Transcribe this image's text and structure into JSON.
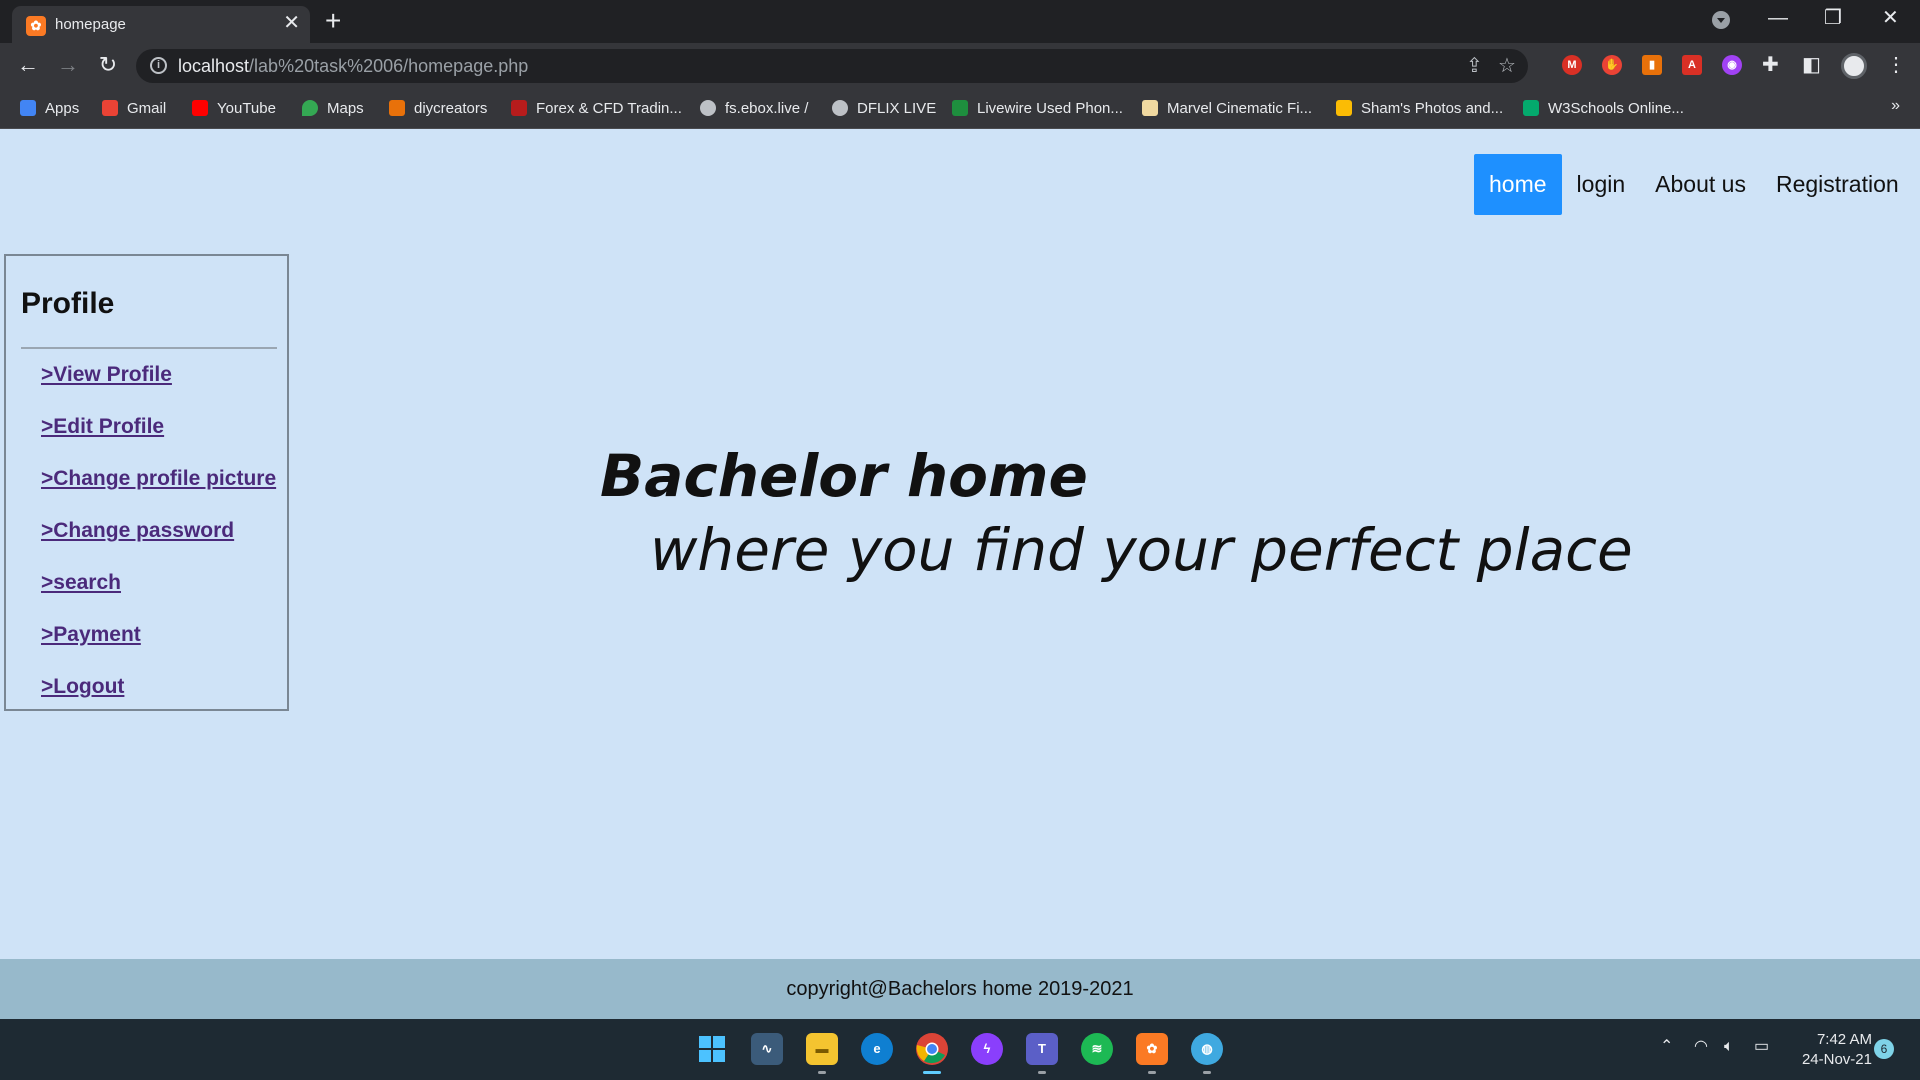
{
  "browser": {
    "tab_title": "homepage",
    "tab_close": "✕",
    "new_tab": "+",
    "url_host": "localhost",
    "url_path": "/lab%20task%2006/homepage.php",
    "window_controls": [
      "—",
      "❐",
      "✕"
    ],
    "bookmarks": [
      {
        "label": "Apps",
        "icon": "apps-grid-icon",
        "color": "#4285f4"
      },
      {
        "label": "Gmail",
        "icon": "gmail-icon",
        "color": "#ea4335"
      },
      {
        "label": "YouTube",
        "icon": "youtube-icon",
        "color": "#ff0000"
      },
      {
        "label": "Maps",
        "icon": "maps-pin-icon",
        "color": "#34a853"
      },
      {
        "label": "diycreators",
        "icon": "diycreators-icon",
        "color": "#e8710a"
      },
      {
        "label": "Forex & CFD Tradin...",
        "icon": "forex-icon",
        "color": "#b71c1c"
      },
      {
        "label": "fs.ebox.live /",
        "icon": "globe-icon",
        "color": "#bdc1c6"
      },
      {
        "label": "DFLIX LIVE",
        "icon": "globe-icon",
        "color": "#bdc1c6"
      },
      {
        "label": "Livewire Used Phon...",
        "icon": "livewire-icon",
        "color": "#1e8e3e"
      },
      {
        "label": "Marvel Cinematic Fi...",
        "icon": "marvel-icon",
        "color": "#f0d9a0"
      },
      {
        "label": "Sham's Photos and...",
        "icon": "drive-icon",
        "color": "#fbbc04"
      },
      {
        "label": "W3Schools Online...",
        "icon": "w3schools-icon",
        "color": "#04aa6d"
      }
    ],
    "bookmarks_more": "»"
  },
  "site": {
    "nav": {
      "home": "home",
      "login": "login",
      "about": "About us",
      "registration": "Registration"
    },
    "sidebar": {
      "title": "Profile",
      "links": [
        ">View Profile",
        ">Edit Profile",
        ">Change profile picture",
        ">Change password",
        ">search",
        ">Payment",
        ">Logout"
      ]
    },
    "hero": {
      "line1": "Bachelor home",
      "line2": "where you find your perfect place"
    },
    "footer": "copyright@Bachelors home 2019-2021"
  },
  "taskbar": {
    "time": "7:42 AM",
    "date": "24-Nov-21",
    "notification_count": "6",
    "apps": [
      "windows-start-icon",
      "photos-icon",
      "file-explorer-icon",
      "edge-icon",
      "chrome-icon",
      "messenger-icon",
      "teams-icon",
      "spotify-icon",
      "xampp-icon",
      "globe-app-icon"
    ]
  },
  "colors": {
    "page_bg": "#cfe3f7",
    "nav_active": "#1e90ff",
    "footer_bg": "#97b9cb",
    "link": "#4b2a7b"
  }
}
